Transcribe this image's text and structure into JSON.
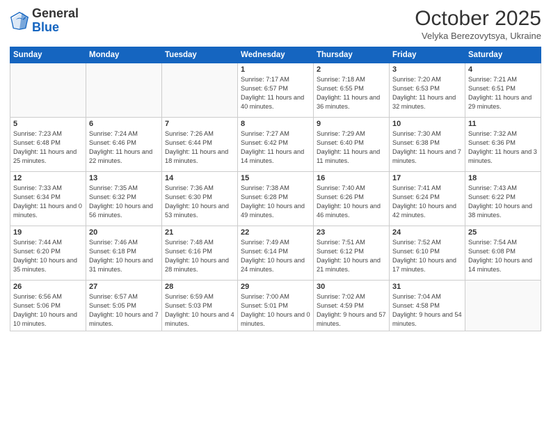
{
  "logo": {
    "general": "General",
    "blue": "Blue"
  },
  "header": {
    "month": "October 2025",
    "location": "Velyka Berezovytsya, Ukraine"
  },
  "days_of_week": [
    "Sunday",
    "Monday",
    "Tuesday",
    "Wednesday",
    "Thursday",
    "Friday",
    "Saturday"
  ],
  "weeks": [
    [
      {
        "day": "",
        "info": ""
      },
      {
        "day": "",
        "info": ""
      },
      {
        "day": "",
        "info": ""
      },
      {
        "day": "1",
        "info": "Sunrise: 7:17 AM\nSunset: 6:57 PM\nDaylight: 11 hours and 40 minutes."
      },
      {
        "day": "2",
        "info": "Sunrise: 7:18 AM\nSunset: 6:55 PM\nDaylight: 11 hours and 36 minutes."
      },
      {
        "day": "3",
        "info": "Sunrise: 7:20 AM\nSunset: 6:53 PM\nDaylight: 11 hours and 32 minutes."
      },
      {
        "day": "4",
        "info": "Sunrise: 7:21 AM\nSunset: 6:51 PM\nDaylight: 11 hours and 29 minutes."
      }
    ],
    [
      {
        "day": "5",
        "info": "Sunrise: 7:23 AM\nSunset: 6:48 PM\nDaylight: 11 hours and 25 minutes."
      },
      {
        "day": "6",
        "info": "Sunrise: 7:24 AM\nSunset: 6:46 PM\nDaylight: 11 hours and 22 minutes."
      },
      {
        "day": "7",
        "info": "Sunrise: 7:26 AM\nSunset: 6:44 PM\nDaylight: 11 hours and 18 minutes."
      },
      {
        "day": "8",
        "info": "Sunrise: 7:27 AM\nSunset: 6:42 PM\nDaylight: 11 hours and 14 minutes."
      },
      {
        "day": "9",
        "info": "Sunrise: 7:29 AM\nSunset: 6:40 PM\nDaylight: 11 hours and 11 minutes."
      },
      {
        "day": "10",
        "info": "Sunrise: 7:30 AM\nSunset: 6:38 PM\nDaylight: 11 hours and 7 minutes."
      },
      {
        "day": "11",
        "info": "Sunrise: 7:32 AM\nSunset: 6:36 PM\nDaylight: 11 hours and 3 minutes."
      }
    ],
    [
      {
        "day": "12",
        "info": "Sunrise: 7:33 AM\nSunset: 6:34 PM\nDaylight: 11 hours and 0 minutes."
      },
      {
        "day": "13",
        "info": "Sunrise: 7:35 AM\nSunset: 6:32 PM\nDaylight: 10 hours and 56 minutes."
      },
      {
        "day": "14",
        "info": "Sunrise: 7:36 AM\nSunset: 6:30 PM\nDaylight: 10 hours and 53 minutes."
      },
      {
        "day": "15",
        "info": "Sunrise: 7:38 AM\nSunset: 6:28 PM\nDaylight: 10 hours and 49 minutes."
      },
      {
        "day": "16",
        "info": "Sunrise: 7:40 AM\nSunset: 6:26 PM\nDaylight: 10 hours and 46 minutes."
      },
      {
        "day": "17",
        "info": "Sunrise: 7:41 AM\nSunset: 6:24 PM\nDaylight: 10 hours and 42 minutes."
      },
      {
        "day": "18",
        "info": "Sunrise: 7:43 AM\nSunset: 6:22 PM\nDaylight: 10 hours and 38 minutes."
      }
    ],
    [
      {
        "day": "19",
        "info": "Sunrise: 7:44 AM\nSunset: 6:20 PM\nDaylight: 10 hours and 35 minutes."
      },
      {
        "day": "20",
        "info": "Sunrise: 7:46 AM\nSunset: 6:18 PM\nDaylight: 10 hours and 31 minutes."
      },
      {
        "day": "21",
        "info": "Sunrise: 7:48 AM\nSunset: 6:16 PM\nDaylight: 10 hours and 28 minutes."
      },
      {
        "day": "22",
        "info": "Sunrise: 7:49 AM\nSunset: 6:14 PM\nDaylight: 10 hours and 24 minutes."
      },
      {
        "day": "23",
        "info": "Sunrise: 7:51 AM\nSunset: 6:12 PM\nDaylight: 10 hours and 21 minutes."
      },
      {
        "day": "24",
        "info": "Sunrise: 7:52 AM\nSunset: 6:10 PM\nDaylight: 10 hours and 17 minutes."
      },
      {
        "day": "25",
        "info": "Sunrise: 7:54 AM\nSunset: 6:08 PM\nDaylight: 10 hours and 14 minutes."
      }
    ],
    [
      {
        "day": "26",
        "info": "Sunrise: 6:56 AM\nSunset: 5:06 PM\nDaylight: 10 hours and 10 minutes."
      },
      {
        "day": "27",
        "info": "Sunrise: 6:57 AM\nSunset: 5:05 PM\nDaylight: 10 hours and 7 minutes."
      },
      {
        "day": "28",
        "info": "Sunrise: 6:59 AM\nSunset: 5:03 PM\nDaylight: 10 hours and 4 minutes."
      },
      {
        "day": "29",
        "info": "Sunrise: 7:00 AM\nSunset: 5:01 PM\nDaylight: 10 hours and 0 minutes."
      },
      {
        "day": "30",
        "info": "Sunrise: 7:02 AM\nSunset: 4:59 PM\nDaylight: 9 hours and 57 minutes."
      },
      {
        "day": "31",
        "info": "Sunrise: 7:04 AM\nSunset: 4:58 PM\nDaylight: 9 hours and 54 minutes."
      },
      {
        "day": "",
        "info": ""
      }
    ]
  ]
}
